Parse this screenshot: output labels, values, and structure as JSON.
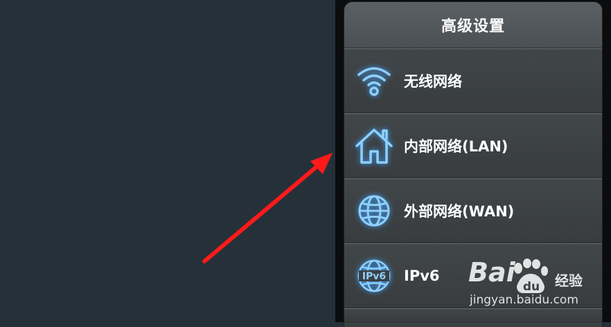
{
  "menu": {
    "title": "高级设置",
    "items": [
      {
        "label": "无线网络",
        "icon": "wifi-icon"
      },
      {
        "label": "内部网络(LAN)",
        "icon": "home-icon"
      },
      {
        "label": "外部网络(WAN)",
        "icon": "globe-icon"
      },
      {
        "label": "IPv6",
        "icon": "ipv6-globe-icon"
      }
    ]
  },
  "annotation": {
    "arrow_color": "#ff1a1a"
  },
  "watermark": {
    "brand_left": "Bai",
    "brand_right": "du",
    "suffix": "经验",
    "url": "jingyan.baidu.com"
  },
  "colors": {
    "background": "#263039",
    "panel": "#3b4043",
    "icon_glow": "#3fa6ff"
  }
}
